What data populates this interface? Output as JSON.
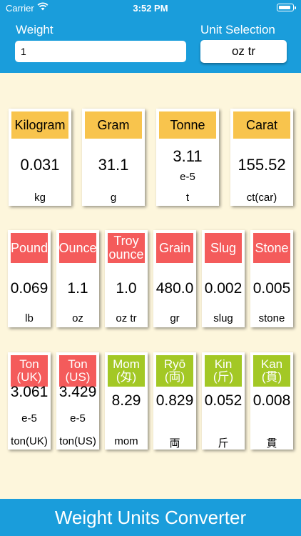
{
  "status": {
    "carrier": "Carrier",
    "time": "3:52 PM"
  },
  "header": {
    "weight_label": "Weight",
    "weight_value": "1",
    "unit_label": "Unit Selection",
    "unit_value": "oz tr"
  },
  "row1": [
    {
      "name": "Kilogram",
      "value": "0.031",
      "exp": "",
      "unit": "kg"
    },
    {
      "name": "Gram",
      "value": "31.1",
      "exp": "",
      "unit": "g"
    },
    {
      "name": "Tonne",
      "value": "3.11",
      "exp": "e-5",
      "unit": "t"
    },
    {
      "name": "Carat",
      "value": "155.52",
      "exp": "",
      "unit": "ct(car)"
    }
  ],
  "row2": [
    {
      "name": "Pound",
      "value": "0.069",
      "exp": "",
      "unit": "lb"
    },
    {
      "name": "Ounce",
      "value": "1.1",
      "exp": "",
      "unit": "oz"
    },
    {
      "name": "Troy ounce",
      "value": "1.0",
      "exp": "",
      "unit": "oz tr"
    },
    {
      "name": "Grain",
      "value": "480.0",
      "exp": "",
      "unit": "gr"
    },
    {
      "name": "Slug",
      "value": "0.002",
      "exp": "",
      "unit": "slug"
    },
    {
      "name": "Stone",
      "value": "0.005",
      "exp": "",
      "unit": "stone"
    }
  ],
  "row3": [
    {
      "name": "Ton (UK)",
      "value": "3.061",
      "exp": "e-5",
      "unit": "ton(UK)"
    },
    {
      "name": "Ton (US)",
      "value": "3.429",
      "exp": "e-5",
      "unit": "ton(US)"
    },
    {
      "name": "Mom (匁)",
      "value": "8.29",
      "exp": "",
      "unit": "mom"
    },
    {
      "name": "Ryō (両)",
      "value": "0.829",
      "exp": "",
      "unit": "両"
    },
    {
      "name": "Kin (斤)",
      "value": "0.052",
      "exp": "",
      "unit": "斤"
    },
    {
      "name": "Kan (貫)",
      "value": "0.008",
      "exp": "",
      "unit": "貫"
    }
  ],
  "footer": {
    "title": "Weight Units Converter"
  },
  "colors": {
    "header": "#1a9ddb",
    "background": "#fdf6dc",
    "yellow": "#f8c44d",
    "red": "#f45b5b",
    "green": "#a3c825"
  }
}
